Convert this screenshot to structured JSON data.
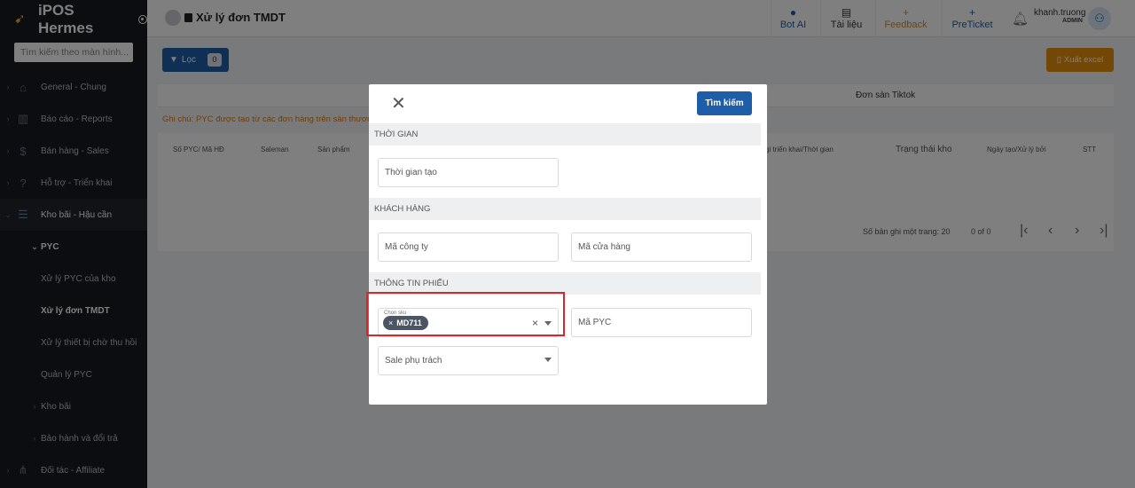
{
  "app": {
    "name": "iPOS Hermes",
    "search_placeholder": "Tìm kiếm theo màn hình..."
  },
  "sidebar": {
    "items": [
      {
        "label": "General - Chung",
        "icon": "home-icon"
      },
      {
        "label": "Báo cáo - Reports",
        "icon": "chart-icon"
      },
      {
        "label": "Bán hàng - Sales",
        "icon": "dollar-icon"
      },
      {
        "label": "Hỗ trợ - Triển khai",
        "icon": "help-icon"
      },
      {
        "label": "Kho bãi - Hậu cần",
        "icon": "list-icon"
      }
    ],
    "pyc_group": "PYC",
    "sub_items": [
      "Xử lý PYC của kho",
      "Xử lý đơn TMDT",
      "Xử lý thiết bị chờ thu hồi",
      "Quản lý PYC"
    ],
    "kho_bai": "Kho bãi",
    "bao_hanh": "Bảo hành và đổi trả",
    "doi_tac": "Đối tác - Affiliate"
  },
  "header": {
    "title": "Xử lý đơn TMDT",
    "bot_ai": "Bot AI",
    "tai_lieu": "Tài liệu",
    "feedback": "Feedback",
    "preticket": "PreTicket",
    "user_name": "khanh.truong",
    "user_role": "ADMIN"
  },
  "toolbar": {
    "filter_label": "Lọc",
    "filter_count": "0",
    "export_label": "Xuất excel"
  },
  "tabs": {
    "tiktok": "Đơn sàn Tiktok"
  },
  "note": "Ghi chú: PYC được tạo từ các đơn hàng trên sàn thương m",
  "table": {
    "headers": [
      "Số PYC/ Mã HĐ",
      "Saleman",
      "Sản phẩm",
      "gi triển khai/Thời gian",
      "Trạng thái kho",
      "Ngày tạo/Xử lý bởi",
      "STT"
    ],
    "pager_label": "Số bản ghi một trang: 20",
    "pager_range": "0 of 0"
  },
  "modal": {
    "search_button": "Tìm kiếm",
    "sections": {
      "time": "Thời gian",
      "customer": "Khách hàng",
      "ticket": "Thông tin phiếu"
    },
    "fields": {
      "created_time": "Thời gian tạo",
      "company_code": "Mã công ty",
      "store_code": "Mã cửa hàng",
      "sku_label": "Chọn sku",
      "sku_value": "MD711",
      "pyc_code": "Mã PYC",
      "sale": "Sale phụ trách"
    }
  },
  "colors": {
    "primary": "#1e5ea8",
    "accent": "#e6900e",
    "highlight": "#d9252b",
    "sidebar_bg": "#171a21"
  }
}
